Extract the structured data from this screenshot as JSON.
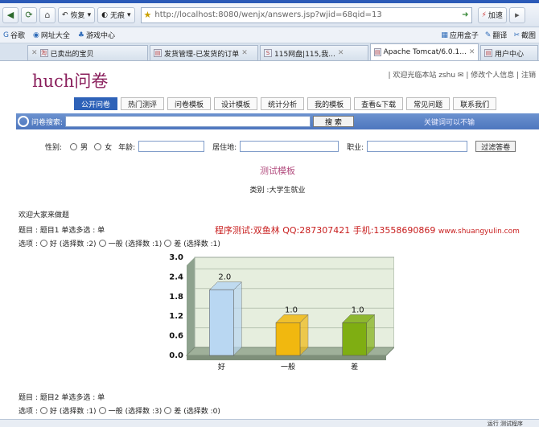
{
  "browser": {
    "back_label": "恢复",
    "favorites_label": "无痕",
    "address": "http://localhost:8080/wenjx/answers.jsp?wjid=68qid=13",
    "accelerate_label": "加速",
    "bookmarks": [
      "谷歌",
      "网址大全",
      "游戏中心"
    ],
    "bookmark_tools": [
      "应用盒子",
      "翻译",
      "截图"
    ],
    "tabs": [
      {
        "label": "已卖出的宝贝"
      },
      {
        "label": "发货管理-已发货的订单"
      },
      {
        "label": "115网盘|115,我..."
      },
      {
        "label": "Apache Tomcat/6.0.1..."
      },
      {
        "label": "用户中心"
      }
    ]
  },
  "site": {
    "logo": "huch问卷",
    "user_links": "| 欢迎光临本站 zshu ✉ | 修改个人信息 | 注销"
  },
  "menu": [
    "公开问卷",
    "热门测评",
    "问卷模板",
    "设计模板",
    "统计分析",
    "我的模板",
    "查看&下载",
    "常见问题",
    "联系我们"
  ],
  "search": {
    "label": "问卷搜索:",
    "button": "搜 索",
    "hint": "关键词可以不输"
  },
  "filters": {
    "gender_label": "性别:",
    "male": "男",
    "female": "女",
    "age_label": "年龄:",
    "residence_label": "居住地:",
    "job_label": "职业:",
    "button": "过滤答卷"
  },
  "survey": {
    "title": "测试模板",
    "category": "类别 :大学生就业",
    "welcome": "欢迎大家来做题",
    "banner_text": "程序测试:双鱼林 QQ:287307421 手机:13558690869",
    "banner_site": "www.shuangyulin.com"
  },
  "q1": {
    "title": "题目 : 题目1 单选多选 : 单",
    "options_label": "选项 :",
    "options": [
      {
        "label": "好",
        "count_text": "(选择数 :2)"
      },
      {
        "label": "一般",
        "count_text": "(选择数 :1)"
      },
      {
        "label": "差",
        "count_text": "(选择数 :1)"
      }
    ]
  },
  "q2": {
    "title": "题目 : 题目2 单选多选 : 单",
    "options_label": "选项 :",
    "options": [
      {
        "label": "好",
        "count_text": "(选择数 :1)"
      },
      {
        "label": "一般",
        "count_text": "(选择数 :3)"
      },
      {
        "label": "差",
        "count_text": "(选择数 :0)"
      }
    ]
  },
  "status_text": "运行 测试程序",
  "chart_data": {
    "type": "bar",
    "categories": [
      "好",
      "一般",
      "差"
    ],
    "values": [
      2.0,
      1.0,
      1.0
    ],
    "data_labels": [
      "2.0",
      "1.0",
      "1.0"
    ],
    "yticks": [
      "0.0",
      "0.6",
      "1.2",
      "1.8",
      "2.4",
      "3.0"
    ],
    "ylim": [
      0,
      3.0
    ],
    "colors": [
      "#b9d7f2",
      "#f1b80f",
      "#7fae12"
    ],
    "grid": true,
    "title": "",
    "xlabel": "",
    "ylabel": ""
  }
}
